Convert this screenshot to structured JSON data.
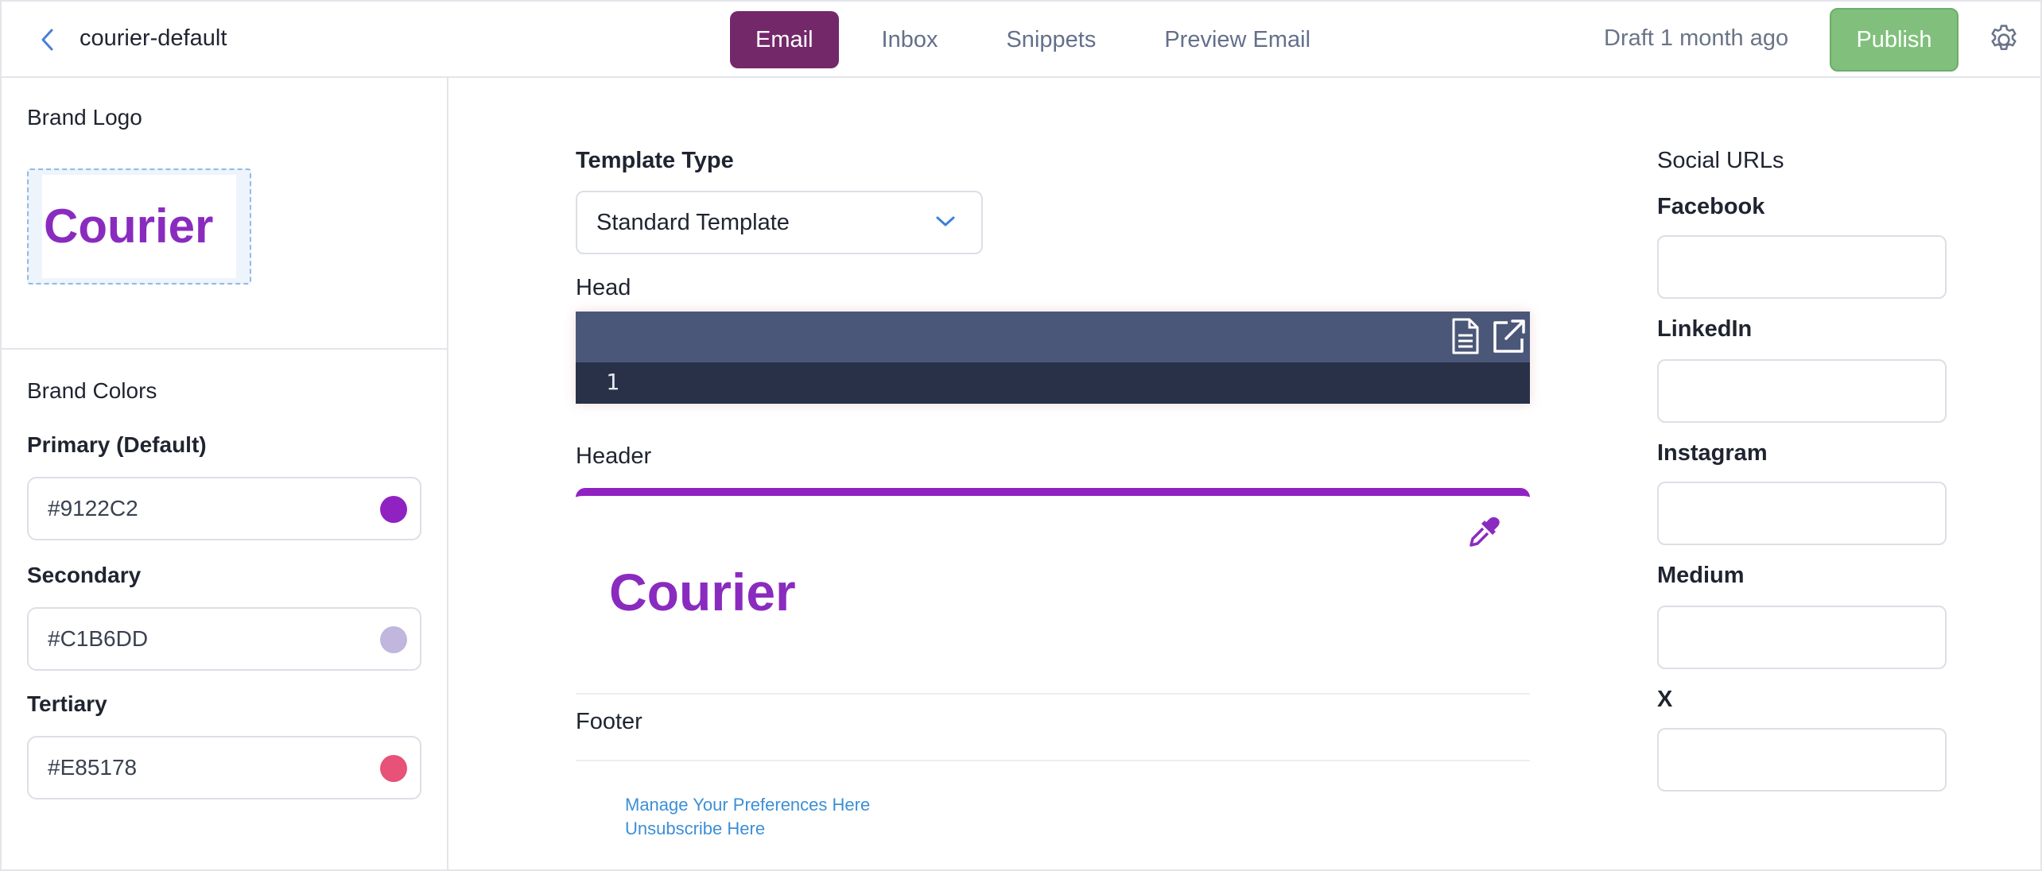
{
  "header": {
    "brand_name": "courier-default",
    "tabs": [
      {
        "label": "Email",
        "active": true
      },
      {
        "label": "Inbox",
        "active": false
      },
      {
        "label": "Snippets",
        "active": false
      },
      {
        "label": "Preview Email",
        "active": false
      }
    ],
    "draft_status": "Draft 1 month ago",
    "publish_label": "Publish"
  },
  "sidebar": {
    "brand_logo_title": "Brand Logo",
    "logo_text": "Courier",
    "brand_colors_title": "Brand Colors",
    "colors": [
      {
        "label": "Primary (Default)",
        "value": "#9122C2",
        "swatch": "#9122c2"
      },
      {
        "label": "Secondary",
        "value": "#C1B6DD",
        "swatch": "#c1b6dd"
      },
      {
        "label": "Tertiary",
        "value": "#E85178",
        "swatch": "#e85178"
      }
    ]
  },
  "main": {
    "template_type_label": "Template Type",
    "template_type_value": "Standard Template",
    "head_label": "Head",
    "editor_line_number": "1",
    "header_label": "Header",
    "header_logo_text": "Courier",
    "footer_label": "Footer",
    "footer_links": [
      "Manage Your Preferences Here",
      "Unsubscribe Here"
    ]
  },
  "social": {
    "title": "Social URLs",
    "fields": [
      {
        "label": "Facebook",
        "value": ""
      },
      {
        "label": "LinkedIn",
        "value": ""
      },
      {
        "label": "Instagram",
        "value": ""
      },
      {
        "label": "Medium",
        "value": ""
      },
      {
        "label": "X",
        "value": ""
      }
    ]
  },
  "colors": {
    "accent_tab": "#73286a",
    "publish_green": "#80c07c",
    "brand_purple": "#9122c2",
    "link_blue": "#3d8fd6"
  }
}
